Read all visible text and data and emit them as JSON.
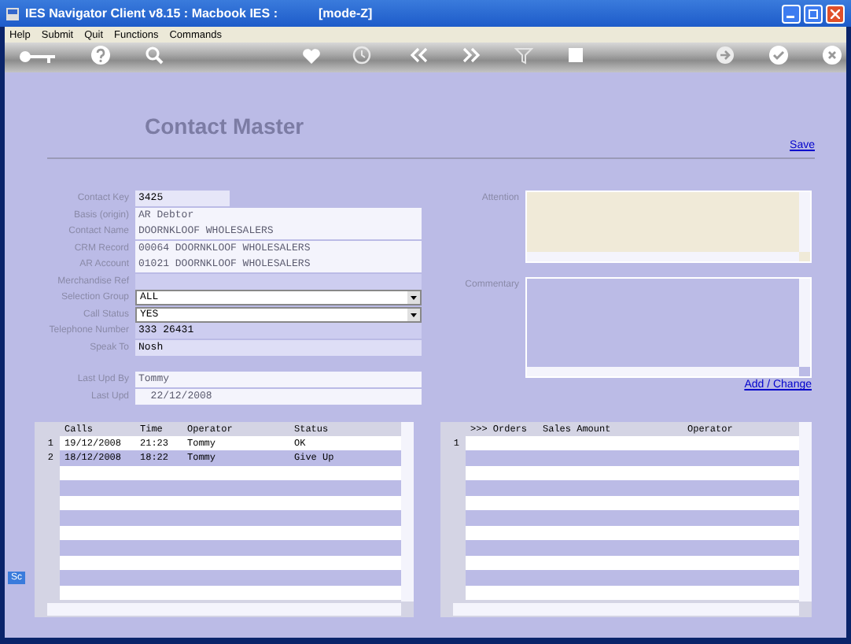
{
  "window": {
    "title": "IES Navigator Client v8.15 : Macbook IES :",
    "mode": "[mode-Z]"
  },
  "menu": [
    "Help",
    "Submit",
    "Quit",
    "Functions",
    "Commands"
  ],
  "page": {
    "title": "Contact Master",
    "save_link": "Save"
  },
  "fields": [
    {
      "label": "Contact Key",
      "value": "3425",
      "kind": "short"
    },
    {
      "label": "Basis (origin)",
      "value": "AR Debtor",
      "kind": "readonly"
    },
    {
      "label": "Contact Name",
      "value": "DOORNKLOOF WHOLESALERS",
      "kind": "readonly"
    },
    {
      "label": "CRM Record",
      "value": "00064 DOORNKLOOF WHOLESALERS",
      "kind": "readonly"
    },
    {
      "label": "AR Account",
      "value": "01021 DOORNKLOOF WHOLESALERS",
      "kind": "readonly"
    },
    {
      "label": "Merchandise Ref",
      "kind": "shaded"
    },
    {
      "label": "Selection Group",
      "value": "ALL",
      "kind": "select"
    },
    {
      "label": "Call Status",
      "value": "YES",
      "kind": "select"
    },
    {
      "label": "Telephone Number",
      "value": "333 26431",
      "kind": "shaded"
    },
    {
      "label": "Speak To",
      "value": "Nosh",
      "kind": "light"
    },
    {
      "label": "Last Upd By",
      "value": "Tommy",
      "kind": "readonly",
      "gap_before": true
    },
    {
      "label": "Last Upd",
      "value": "  22/12/2008",
      "kind": "readonly"
    }
  ],
  "attention": {
    "label": "Attention"
  },
  "commentary": {
    "label": "Commentary"
  },
  "add_change_link": "Add / Change",
  "calls_table": {
    "columns": [
      "Calls",
      "Time",
      "Operator",
      "Status"
    ],
    "rows": [
      {
        "number": "1",
        "cells": [
          "19/12/2008",
          "21:23",
          "Tommy",
          "OK"
        ]
      },
      {
        "number": "2",
        "cells": [
          "18/12/2008",
          "18:22",
          "Tommy",
          "Give Up"
        ]
      }
    ]
  },
  "orders_table": {
    "columns": [
      ">>> Orders",
      "Sales Amount",
      "Operator"
    ],
    "rows": [
      {
        "number": "1",
        "cells": []
      }
    ]
  },
  "side_tab": "Sc"
}
